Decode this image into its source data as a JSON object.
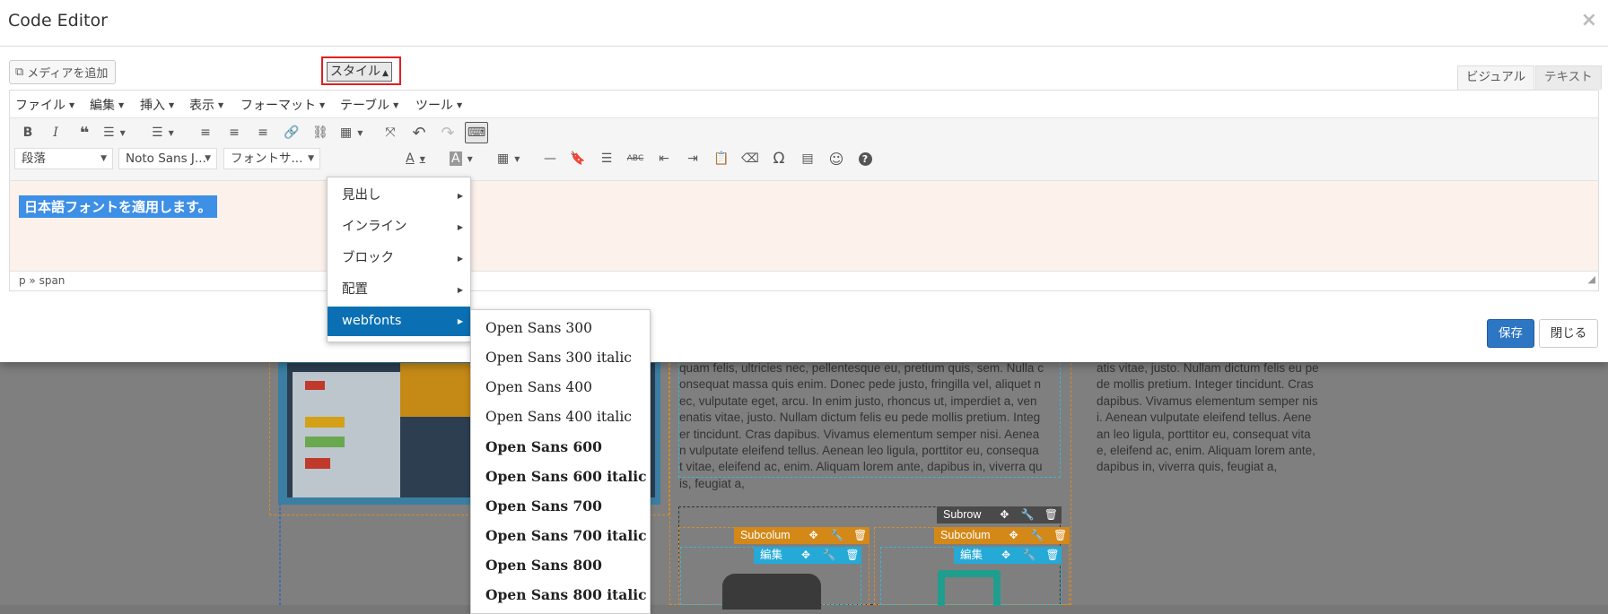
{
  "modal": {
    "title": "Code Editor",
    "close_icon": "×"
  },
  "media_button": {
    "label": "メディアを追加"
  },
  "mode_tabs": {
    "visual": "ビジュアル",
    "text": "テキスト"
  },
  "menubar": [
    "ファイル",
    "編集",
    "挿入",
    "表示",
    "フォーマット",
    "テーブル",
    "ツール"
  ],
  "toolbar2": {
    "block_format": "段落",
    "font_family": "Noto Sans J...",
    "font_size": "フォントサ...",
    "style": "スタイル"
  },
  "content": {
    "selected_text": "日本語フォントを適用します。"
  },
  "statusbar": {
    "path": "p » span"
  },
  "buttons": {
    "save": "保存",
    "close": "閉じる"
  },
  "style_menu": [
    {
      "label": "見出し"
    },
    {
      "label": "インライン"
    },
    {
      "label": "ブロック"
    },
    {
      "label": "配置"
    },
    {
      "label": "webfonts",
      "active": true
    }
  ],
  "webfonts_menu": [
    "Open Sans 300",
    "Open Sans 300 italic",
    "Open Sans 400",
    "Open Sans 400 italic",
    "Open Sans 600",
    "Open Sans 600 italic",
    "Open Sans 700",
    "Open Sans 700 italic",
    "Open Sans 800",
    "Open Sans 800 italic"
  ],
  "background": {
    "lorem_middle": [
      "quam felis, ultricies nec, pellentesque eu, pretium quis, sem. Nulla c",
      "onsequat massa quis enim. Donec pede justo, fringilla vel, aliquet n",
      "ec, vulputate eget, arcu. In enim justo, rhoncus ut, imperdiet a, ven",
      "enatis vitae, justo. Nullam dictum felis eu pede mollis pretium. Integ",
      "er tincidunt. Cras dapibus. Vivamus elementum semper nisi. Aenea",
      "n vulputate eleifend tellus. Aenean leo ligula, porttitor eu, consequa",
      "t vitae, eleifend ac, enim. Aliquam lorem ante, dapibus in, viverra qu",
      "is, feugiat a,"
    ],
    "lorem_right": [
      "atis vitae, justo. Nullam dictum felis eu pe",
      "de mollis pretium. Integer tincidunt. Cras",
      "dapibus. Vivamus elementum semper nis",
      "i. Aenean vulputate eleifend tellus. Aene",
      "an leo ligula, porttitor eu, consequat vita",
      "e, eleifend ac, enim. Aliquam lorem ante,",
      "dapibus in, viverra quis, feugiat a,"
    ],
    "subrow_label": "Subrow",
    "subcolum_label": "Subcolum",
    "edit_label": "編集"
  },
  "colors": {
    "primary": "#2d76c4",
    "active_menu": "#0a70b3",
    "highlight": "#3e8fe6",
    "content_bg": "#fdf1ec",
    "red_outline": "#e02020",
    "subcolum": "#d48818",
    "edit_bar": "#25a9d6"
  }
}
